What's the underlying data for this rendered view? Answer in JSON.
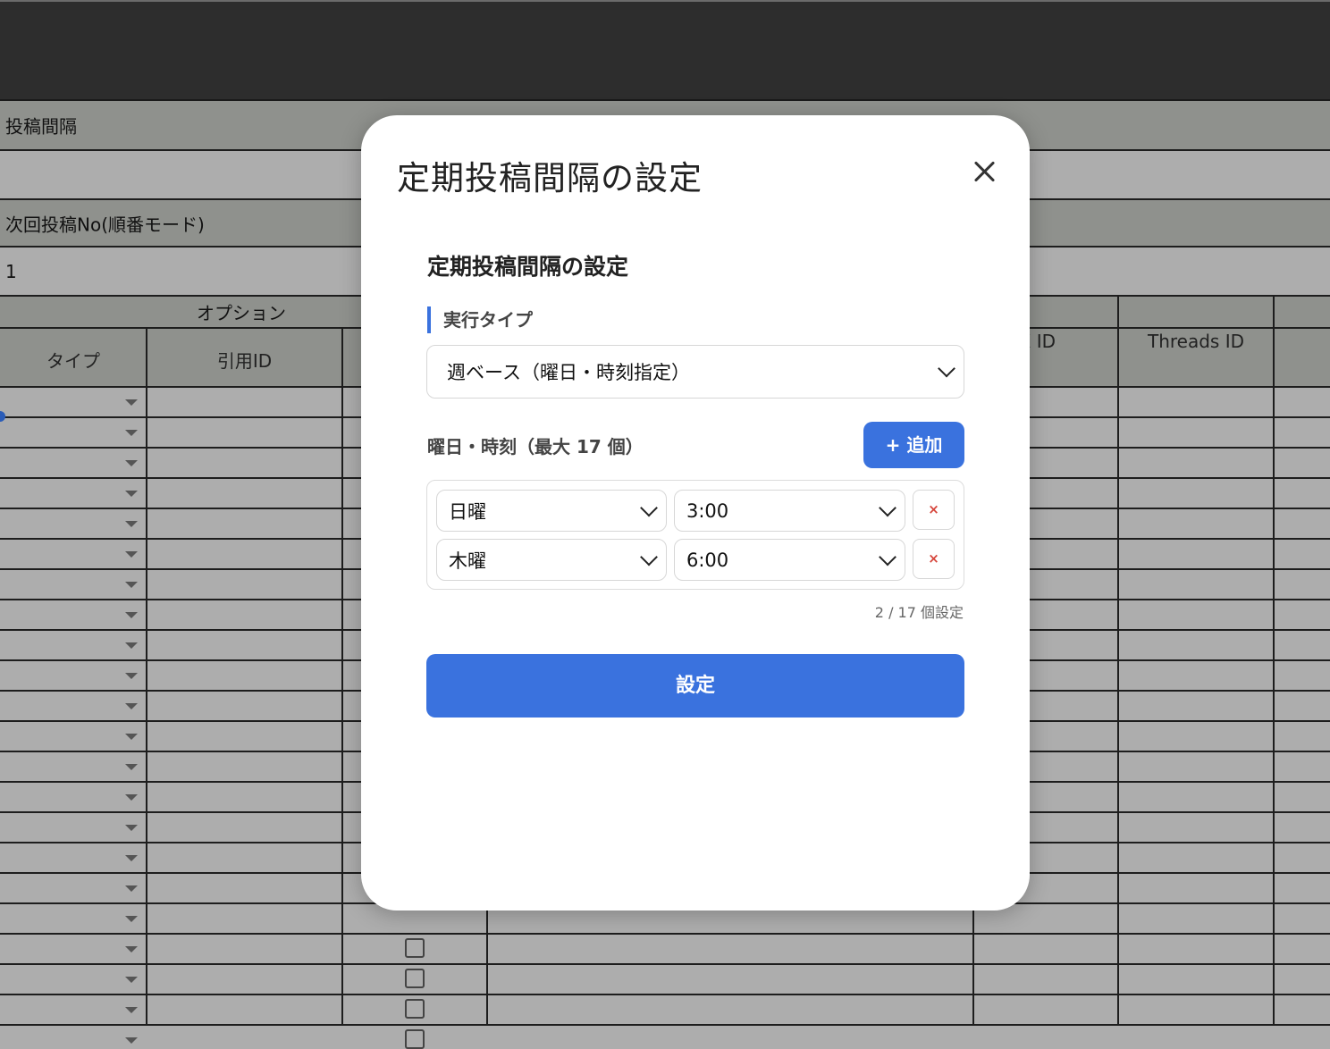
{
  "sheet": {
    "row_interval_label": "投稿間隔",
    "row_next_label": "次回投稿No(順番モード)",
    "row_next_value": "1",
    "group_header": "オプション",
    "columns": {
      "type": "タイプ",
      "quote_id": "引用ID",
      "x_id": "X ID",
      "threads_id": "Threads ID"
    }
  },
  "modal": {
    "title": "定期投稿間隔の設定",
    "section_title": "定期投稿間隔の設定",
    "exec_type_label": "実行タイプ",
    "exec_type_value": "週ベース（曜日・時刻指定）",
    "slots_label": "曜日・時刻（最大 17 個）",
    "add_button": "+ 追加",
    "slots": [
      {
        "day": "日曜",
        "time": "3:00",
        "delete": "×"
      },
      {
        "day": "木曜",
        "time": "6:00",
        "delete": "×"
      }
    ],
    "count_text": "2 / 17 個設定",
    "submit_button": "設定"
  },
  "colors": {
    "accent": "#3a72de",
    "delete": "#d6463c",
    "topbar": "#2d2d2d",
    "sheet": "#adadad"
  }
}
